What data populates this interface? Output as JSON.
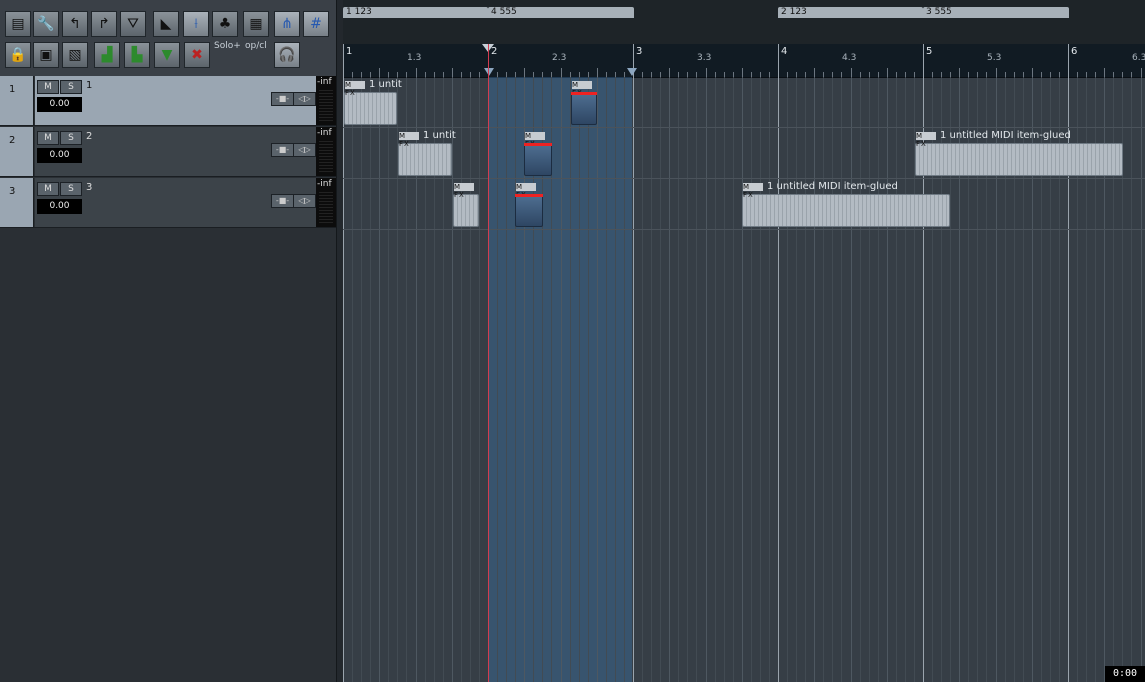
{
  "toolbar": {
    "row1": [
      "metronome-panel",
      "wrench",
      "undo",
      "redo",
      "metronome",
      "ripple-edit",
      "split",
      "clover",
      "grid",
      "envelope",
      "snap-grid"
    ],
    "row2": [
      "lock",
      "midi-item",
      "save-item",
      "green-track-a",
      "green-track-b",
      "track-down",
      "track-remove",
      "headphones"
    ],
    "solo_label": "Solo+",
    "op_label": "op/cl"
  },
  "tracks": [
    {
      "num": "1",
      "name": "1",
      "vol": "0.00",
      "meter": "-inf",
      "mute": "M",
      "solo": "S",
      "selected": true
    },
    {
      "num": "2",
      "name": "2",
      "vol": "0.00",
      "meter": "-inf",
      "mute": "M",
      "solo": "S",
      "selected": false
    },
    {
      "num": "3",
      "name": "3",
      "vol": "0.00",
      "meter": "-inf",
      "mute": "M",
      "solo": "S",
      "selected": false
    }
  ],
  "regions": [
    {
      "label": "1  123"
    },
    {
      "label": "4  555"
    },
    {
      "label": "2  123"
    },
    {
      "label": "3  555"
    }
  ],
  "ruler": {
    "major": [
      "1",
      "2",
      "3",
      "4",
      "5",
      "6"
    ],
    "minor": [
      "1.3",
      "2.3",
      "3.3",
      "4.3",
      "5.3",
      "6.3"
    ]
  },
  "items": {
    "t1a": "1 untit",
    "t2a": "1 untit",
    "t2b": "1 untitled MIDI item-glued",
    "t3b": "1 untitled MIDI item-glued",
    "icons": "M FX"
  },
  "timecode": "0:00"
}
